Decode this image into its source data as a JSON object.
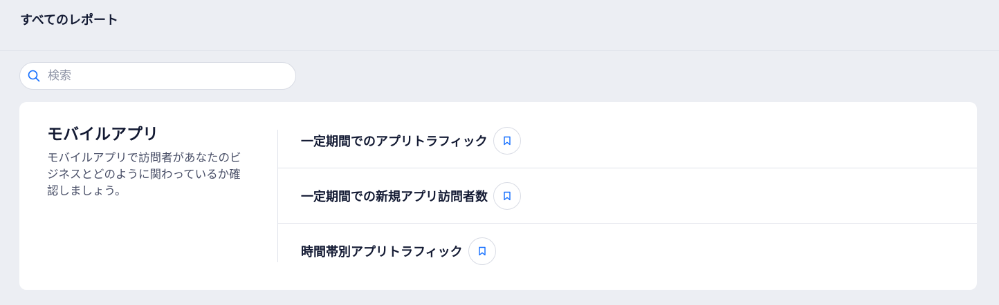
{
  "header": {
    "title": "すべてのレポート"
  },
  "search": {
    "placeholder": "検索",
    "value": "",
    "icon": "search-icon"
  },
  "category": {
    "title": "モバイルアプリ",
    "description": "モバイルアプリで訪問者があなたのビジネスとどのように関わっているか確認しましょう。"
  },
  "reports": [
    {
      "label": "一定期間でのアプリトラフィック",
      "icon": "bookmark-icon"
    },
    {
      "label": "一定期間での新規アプリ訪問者数",
      "icon": "bookmark-icon"
    },
    {
      "label": "時間帯別アプリトラフィック",
      "icon": "bookmark-icon"
    }
  ],
  "colors": {
    "background": "#eceef3",
    "card": "#ffffff",
    "text": "#131a33",
    "accent": "#116dff",
    "border": "#d8dbe4"
  }
}
